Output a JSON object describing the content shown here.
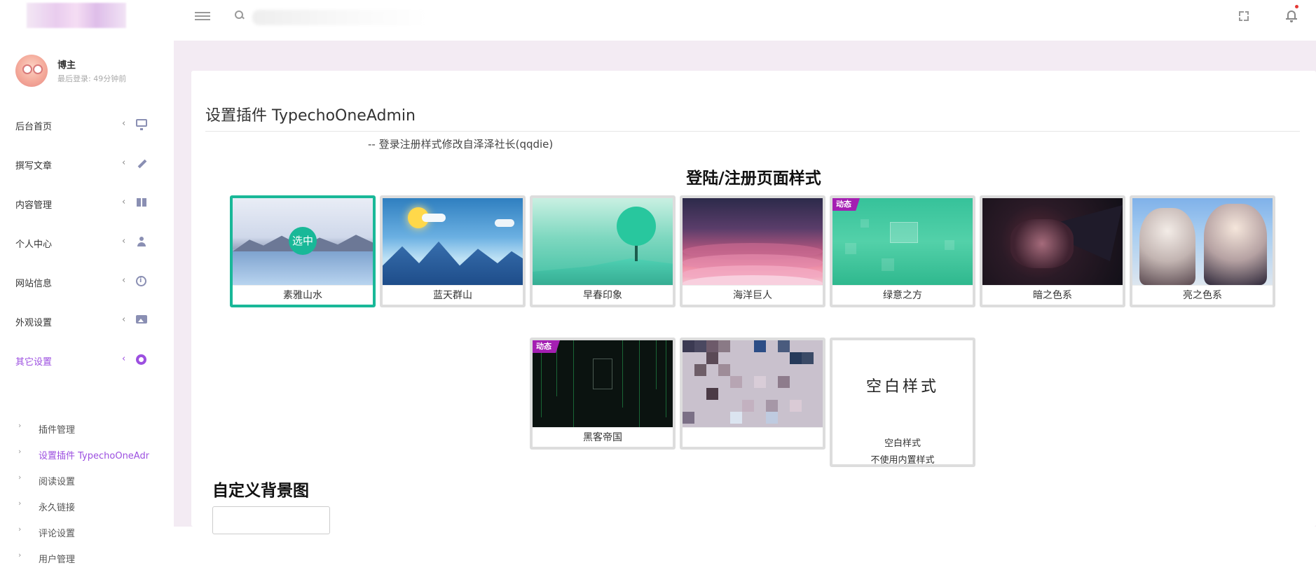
{
  "profile": {
    "name": "博主",
    "last_login": "最后登录: 49分钟前"
  },
  "nav": [
    {
      "label": "后台首页",
      "icon": "monitor-icon"
    },
    {
      "label": "撰写文章",
      "icon": "pencil-icon"
    },
    {
      "label": "内容管理",
      "icon": "book-icon"
    },
    {
      "label": "个人中心",
      "icon": "user-icon"
    },
    {
      "label": "网站信息",
      "icon": "info-icon"
    },
    {
      "label": "外观设置",
      "icon": "image-icon"
    },
    {
      "label": "其它设置",
      "icon": "gear-icon",
      "active": true
    }
  ],
  "subnav": [
    {
      "label": "插件管理"
    },
    {
      "label": "设置插件 TypechoOneAdmin",
      "active": true
    },
    {
      "label": "阅读设置"
    },
    {
      "label": "永久链接"
    },
    {
      "label": "评论设置"
    },
    {
      "label": "用户管理"
    }
  ],
  "page": {
    "title": "设置插件 TypechoOneAdmin",
    "subtitle": "-- 登录注册样式修改自泽泽社长(qqdie)",
    "section_title": "登陆/注册页面样式",
    "selected_label": "选中",
    "dynamic_badge": "动态",
    "custom_bg_title": "自定义背景图"
  },
  "styles_row1": [
    {
      "caption": "素雅山水",
      "selected": true
    },
    {
      "caption": "蓝天群山"
    },
    {
      "caption": "早春印象"
    },
    {
      "caption": "海洋巨人"
    },
    {
      "caption": "绿意之方",
      "dynamic": true
    },
    {
      "caption": "暗之色系"
    },
    {
      "caption": "亮之色系"
    }
  ],
  "styles_row2": [
    {
      "caption": "黑客帝国",
      "dynamic": true
    },
    {
      "caption": ""
    },
    {
      "caption": "空白样式",
      "caption2": "不使用内置样式",
      "thumb_text": "空白样式"
    }
  ],
  "colors": {
    "accent": "#9c4fe0",
    "selected_border": "#19b898",
    "main_bg": "#f3ebf3",
    "badge": "#a41fb2"
  }
}
